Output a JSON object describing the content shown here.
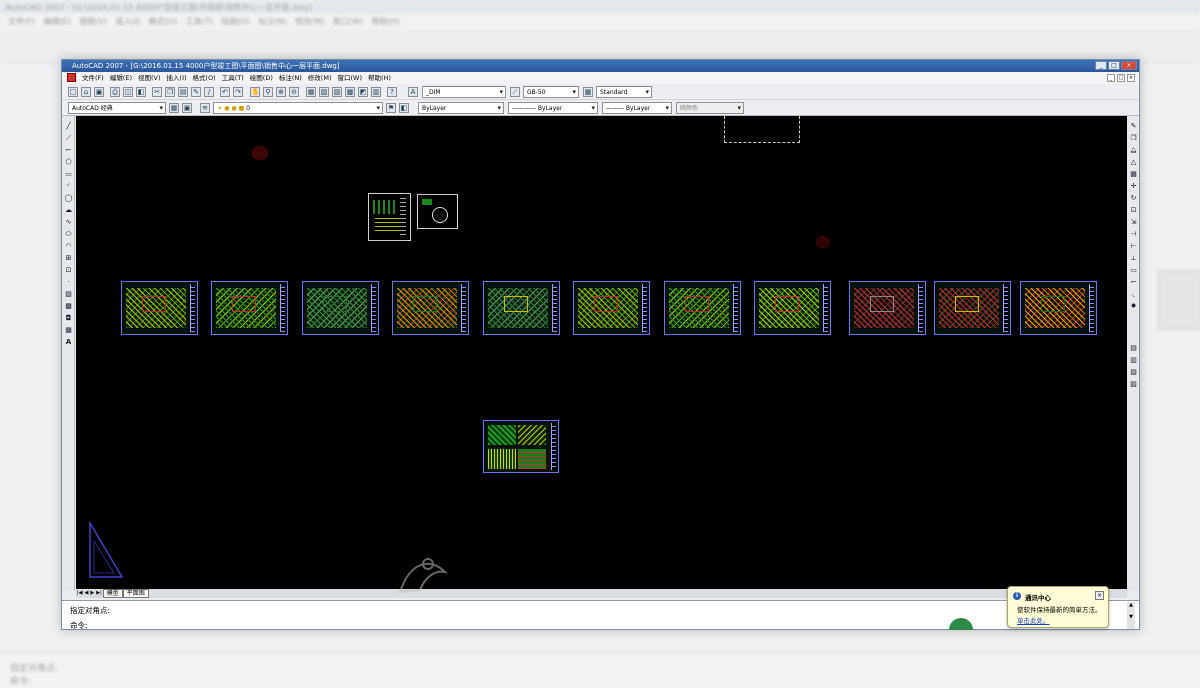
{
  "background": {
    "title": "AutoCAD 2007 - [G:\\2016.01.15  4000户型竣工图\\平面图\\销售中心一层平面.dwg]",
    "menu": "文件(F)  编辑(E)  视图(V)  插入(I)  格式(O)  工具(T)  绘图(D)  标注(N)  修改(M)  窗口(W)  帮助(H)",
    "cmd_prompt": "指定对角点:",
    "cmd_line": "命令:"
  },
  "window": {
    "title": "AutoCAD 2007 - [G:\\2016.01.15  4000户型竣工图\\平面图\\销售中心一层平面.dwg]",
    "controls": [
      "_",
      "□",
      "×"
    ],
    "doc_controls": [
      "_",
      "□",
      "×"
    ]
  },
  "menu": [
    "文件(F)",
    "编辑(E)",
    "视图(V)",
    "插入(I)",
    "格式(O)",
    "工具(T)",
    "绘图(D)",
    "标注(N)",
    "修改(M)",
    "窗口(W)",
    "帮助(H)"
  ],
  "toolbar1": {
    "text_style": "_DIM",
    "dim_style": "GB-50",
    "table_style": "Standard"
  },
  "toolbar2": {
    "workspace": "AutoCAD 经典",
    "layer": "0",
    "color": "ByLayer",
    "linetype": "———— ByLayer",
    "lineweight": "——— ByLayer",
    "plotstyle": "随颜色"
  },
  "tabs": {
    "nav": [
      "|◀",
      "◀",
      "▶",
      "▶|"
    ],
    "items": [
      "模型",
      "平面图"
    ]
  },
  "command": {
    "prompt": "指定对角点:",
    "line": "命令:"
  },
  "notification": {
    "title": "通讯中心",
    "message": "使软件保持最新的简单方法。",
    "link": "单击此处。"
  },
  "colors": {
    "canvas": "#000000",
    "sheet_border": "#7070ff",
    "title_bar": "#2a579a"
  }
}
